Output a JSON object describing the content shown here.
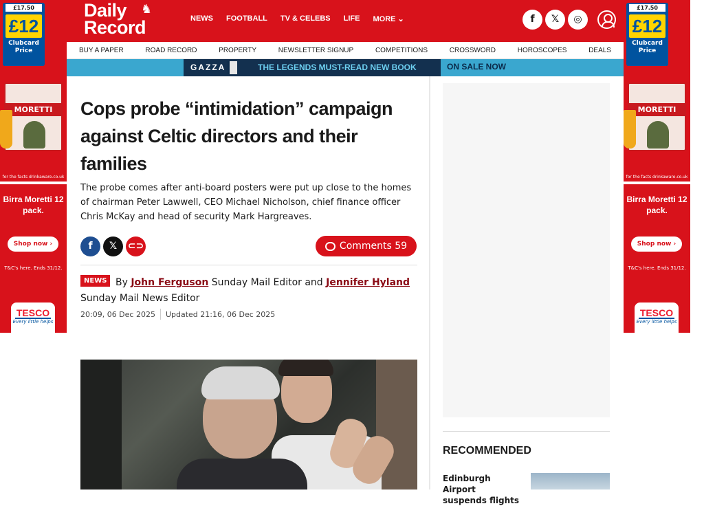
{
  "ads": {
    "was_price": "£17.50",
    "price": "£12",
    "clubcard_label": "Clubcard Price",
    "box_brand": "MORETTI",
    "drinkaware": "for the facts drinkaware.co.uk",
    "product": "Birra Moretti 12 pack.",
    "shop_now": "Shop now ›",
    "terms": "T&C's here. Ends 31/12.",
    "tesco": "TESCO",
    "tesco_tag": "Every little helps"
  },
  "header": {
    "logo_line1": "Daily",
    "logo_line2": "Record",
    "nav": [
      "NEWS",
      "FOOTBALL",
      "TV & CELEBS",
      "LIFE",
      "MORE ⌄"
    ],
    "social": [
      "f",
      "𝕏",
      "◎"
    ]
  },
  "subnav": [
    "BUY A PAPER",
    "ROAD RECORD",
    "PROPERTY",
    "NEWSLETTER SIGNUP",
    "COMPETITIONS",
    "CROSSWORD",
    "HOROSCOPES",
    "DEALS"
  ],
  "banner": {
    "gazza": "GAZZA",
    "text": "THE LEGENDS MUST-READ NEW BOOK",
    "cta": "ON SALE NOW"
  },
  "article": {
    "headline": "Cops probe “intimidation” campaign against Celtic directors and their families",
    "standfirst": "The probe comes after anti-board posters were put up close to the homes of chairman Peter Lawwell, CEO Michael Nicholson, chief finance officer Chris McKay and head of security Mark Hargreaves.",
    "comments_label": "Comments 59",
    "tag": "NEWS",
    "by": "By",
    "author1": "John Ferguson",
    "role1": "Sunday Mail Editor and",
    "author2": "Jennifer Hyland",
    "role2": "Sunday Mail News Editor",
    "published": "20:09, 06 Dec 2025",
    "updated": "Updated 21:16, 06 Dec 2025"
  },
  "sidebar": {
    "recommended": "RECOMMENDED",
    "rec_title": "Edinburgh Airport suspends flights"
  },
  "colors": {
    "brand_red": "#d8121b",
    "banner_blue": "#3aa7cf",
    "banner_navy": "#13304f",
    "author_link": "#8a0a14"
  }
}
